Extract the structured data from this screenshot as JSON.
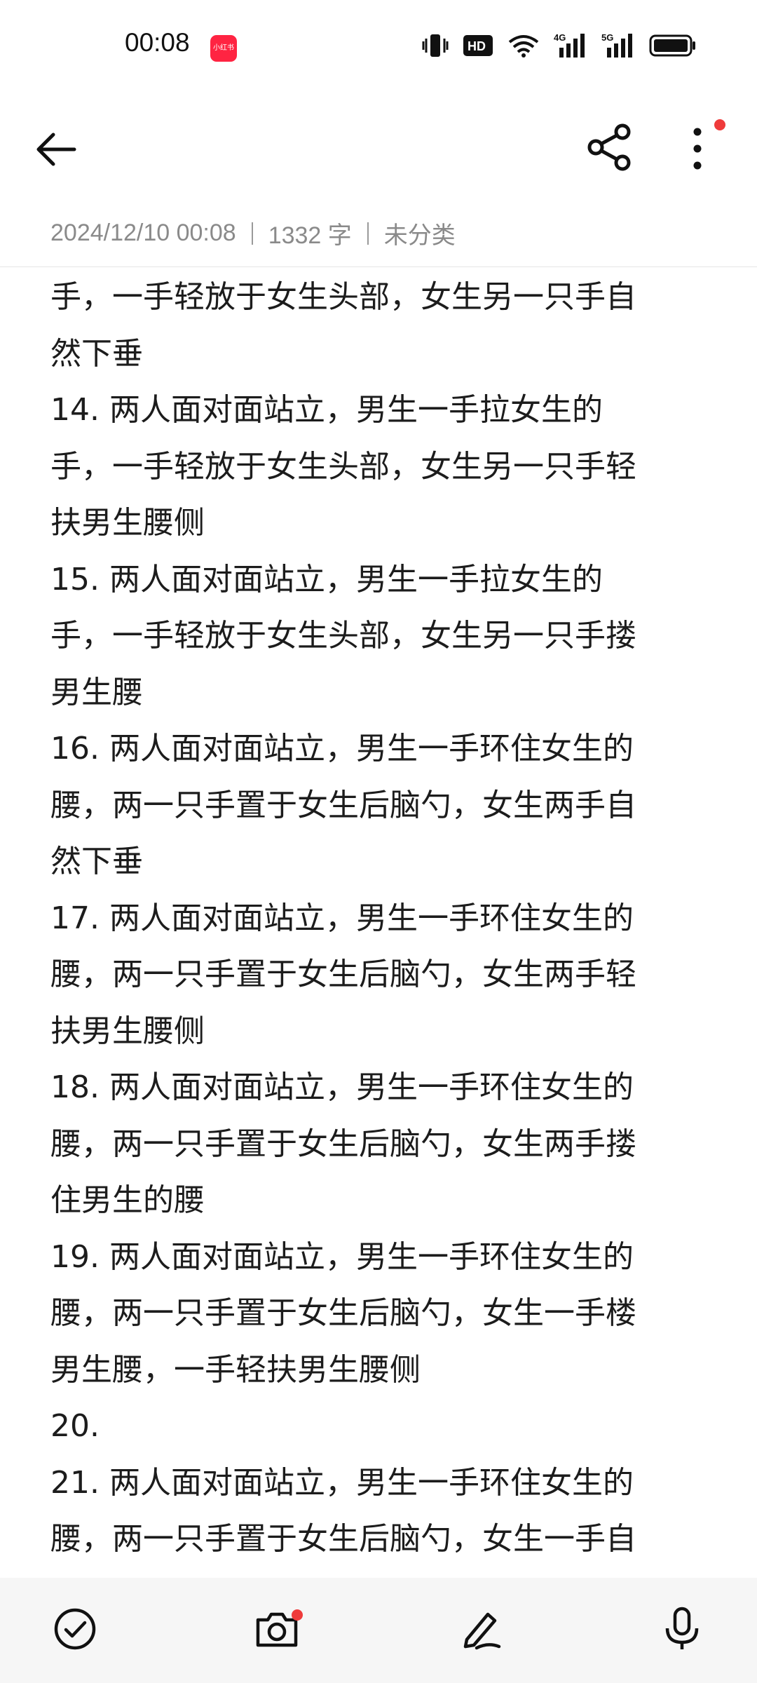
{
  "status_bar": {
    "time": "00:08",
    "app_badge": "小红书",
    "icons": [
      "vibrate-icon",
      "hd-icon",
      "wifi-icon",
      "signal-4g-icon",
      "signal-5g-icon",
      "battery-icon"
    ],
    "hd_label": "HD",
    "net1_label": "4G",
    "net2_label": "5G"
  },
  "app_bar": {
    "icons": [
      "back-arrow-icon",
      "share-icon",
      "more-vertical-icon"
    ],
    "notification_dot_color": "#ef3b3b"
  },
  "meta": {
    "datetime": "2024/12/10 00:08",
    "word_count": "1332 字",
    "category": "未分类"
  },
  "note": {
    "lines": [
      "手，一手轻放于女生头部，女生另一只手自",
      "然下垂",
      "14. 两人面对面站立，男生一手拉女生的",
      "手，一手轻放于女生头部，女生另一只手轻",
      "扶男生腰侧",
      "15. 两人面对面站立，男生一手拉女生的",
      "手，一手轻放于女生头部，女生另一只手搂",
      "男生腰",
      "16. 两人面对面站立，男生一手环住女生的",
      "腰，两一只手置于女生后脑勺，女生两手自",
      "然下垂",
      "17. 两人面对面站立，男生一手环住女生的",
      "腰，两一只手置于女生后脑勺，女生两手轻",
      "扶男生腰侧",
      "18. 两人面对面站立，男生一手环住女生的",
      "腰，两一只手置于女生后脑勺，女生两手搂",
      "住男生的腰",
      "19. 两人面对面站立，男生一手环住女生的",
      "腰，两一只手置于女生后脑勺，女生一手楼",
      "男生腰，一手轻扶男生腰侧",
      "20.",
      "21. 两人面对面站立，男生一手环住女生的",
      "腰，两一只手置于女生后脑勺，女生一手自"
    ]
  },
  "bottom_toolbar": {
    "icons": [
      "checklist-icon",
      "camera-icon",
      "pen-icon",
      "microphone-icon"
    ]
  }
}
